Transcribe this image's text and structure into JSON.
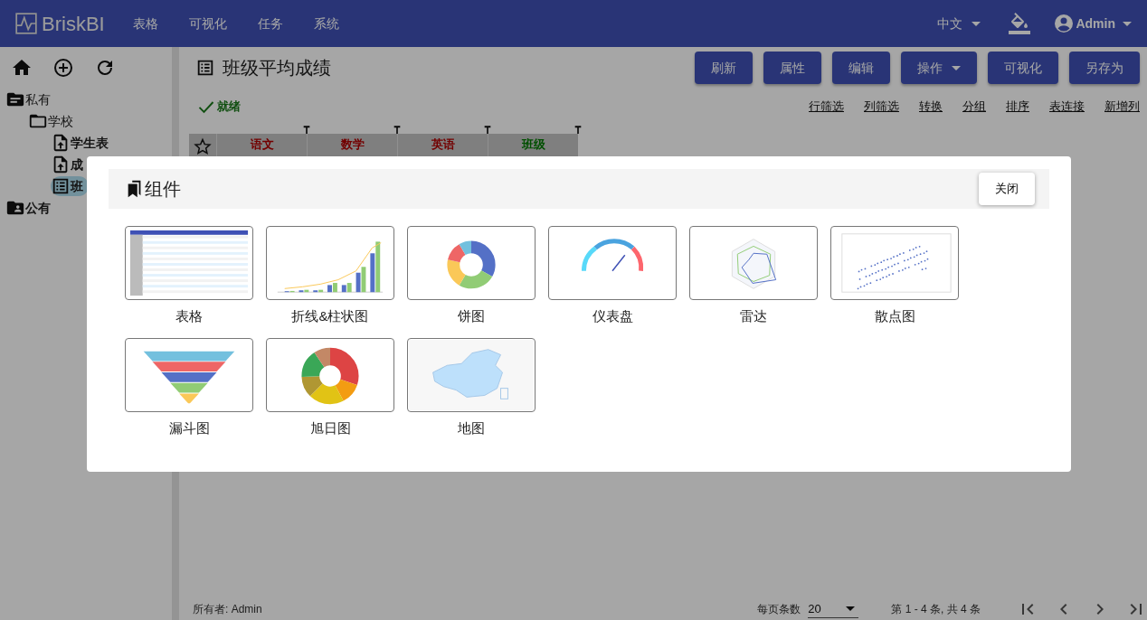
{
  "navbar": {
    "brand": "BriskBI",
    "menu": [
      "表格",
      "可视化",
      "任务",
      "系统"
    ],
    "language": "中文",
    "user": "Admin"
  },
  "sidebar": {
    "tree": [
      {
        "label": "私有",
        "kind": "private",
        "children": [
          {
            "label": "学校",
            "kind": "folder",
            "children": [
              {
                "label": "学生表",
                "kind": "uploaded",
                "selected": false
              },
              {
                "label": "成",
                "kind": "uploaded",
                "selected": false
              },
              {
                "label": "班",
                "kind": "report",
                "selected": true
              }
            ]
          }
        ]
      },
      {
        "label": "公有",
        "kind": "public"
      }
    ]
  },
  "report": {
    "title": "班级平均成绩",
    "status": "就绪",
    "buttons": [
      {
        "label": "刷新",
        "dropdown": false
      },
      {
        "label": "属性",
        "dropdown": false
      },
      {
        "label": "编辑",
        "dropdown": false
      },
      {
        "label": "操作",
        "dropdown": true
      },
      {
        "label": "可视化",
        "dropdown": false
      },
      {
        "label": "另存为",
        "dropdown": false
      }
    ],
    "links": [
      "行筛选",
      "列筛选",
      "转换",
      "分组",
      "排序",
      "表连接",
      "新增列"
    ],
    "columns": [
      {
        "label": "语文",
        "kind": "measure"
      },
      {
        "label": "数学",
        "kind": "measure"
      },
      {
        "label": "英语",
        "kind": "measure"
      },
      {
        "label": "班级",
        "kind": "dimension"
      }
    ]
  },
  "footer": {
    "owner": "所有者: Admin",
    "page_size_label": "每页条数",
    "page_size": "20",
    "range": "第 1 - 4 条, 共 4 条"
  },
  "modal": {
    "title": "组件",
    "close": "关闭",
    "components": [
      {
        "label": "表格",
        "kind": "table"
      },
      {
        "label": "折线&柱状图",
        "kind": "barline"
      },
      {
        "label": "饼图",
        "kind": "donut"
      },
      {
        "label": "仪表盘",
        "kind": "gauge"
      },
      {
        "label": "雷达",
        "kind": "radar"
      },
      {
        "label": "散点图",
        "kind": "scatter"
      },
      {
        "label": "漏斗图",
        "kind": "funnel"
      },
      {
        "label": "旭日图",
        "kind": "sunburst"
      },
      {
        "label": "地图",
        "kind": "map"
      }
    ]
  }
}
